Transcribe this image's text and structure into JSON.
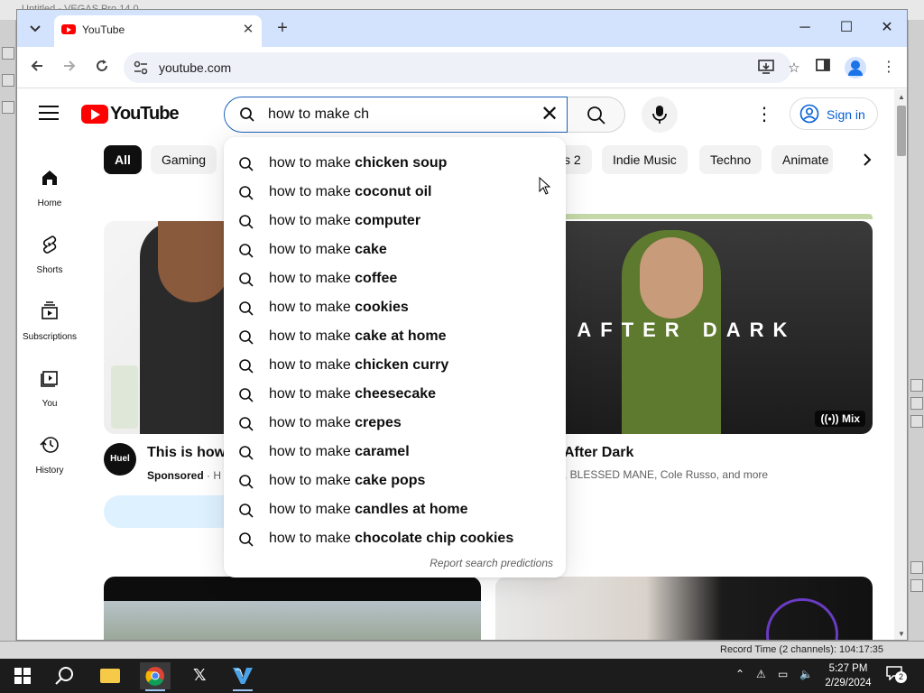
{
  "background_app": {
    "title": "Untitled - VEGAS Pro 14.0",
    "status_text": "Record Time (2 channels): 104:17:35"
  },
  "browser": {
    "tab_title": "YouTube",
    "url": "youtube.com",
    "window_controls": [
      "minimize",
      "maximize",
      "close"
    ]
  },
  "youtube": {
    "logo_text": "YouTube",
    "search_query": "how to make ch",
    "sign_in_label": "Sign in",
    "guide": [
      {
        "label": "Home",
        "icon": "home-icon"
      },
      {
        "label": "Shorts",
        "icon": "shorts-icon"
      },
      {
        "label": "Subscriptions",
        "icon": "subscriptions-icon"
      },
      {
        "label": "You",
        "icon": "you-icon"
      },
      {
        "label": "History",
        "icon": "history-icon"
      }
    ],
    "chips": [
      "All",
      "Gaming",
      "s 2",
      "Indie Music",
      "Techno",
      "Animate"
    ],
    "videos": [
      {
        "title": "This is how",
        "channel_label": "Sponsored",
        "channel_suffix": "· H",
        "avatar_text": "Huel"
      },
      {
        "title": "After Dark",
        "meta": ", BLESSED MANE, Cole Russo, and more",
        "thumb_text": "A AFTER DARK",
        "badge": "Mix"
      }
    ],
    "suggestions": [
      {
        "prefix": "how to make ",
        "bold": "chicken soup"
      },
      {
        "prefix": "how to make ",
        "bold": "coconut oil"
      },
      {
        "prefix": "how to make ",
        "bold": "computer"
      },
      {
        "prefix": "how to make ",
        "bold": "cake"
      },
      {
        "prefix": "how to make ",
        "bold": "coffee"
      },
      {
        "prefix": "how to make ",
        "bold": "cookies"
      },
      {
        "prefix": "how to make ",
        "bold": "cake at home"
      },
      {
        "prefix": "how to make ",
        "bold": "chicken curry"
      },
      {
        "prefix": "how to make ",
        "bold": "cheesecake"
      },
      {
        "prefix": "how to make ",
        "bold": "crepes"
      },
      {
        "prefix": "how to make ",
        "bold": "caramel"
      },
      {
        "prefix": "how to make ",
        "bold": "cake pops"
      },
      {
        "prefix": "how to make ",
        "bold": "candles at home"
      },
      {
        "prefix": "how to make ",
        "bold": "chocolate chip cookies"
      }
    ],
    "report_label": "Report search predictions"
  },
  "taskbar": {
    "time": "5:27 PM",
    "date": "2/29/2024",
    "notification_count": "2"
  },
  "colors": {
    "accent": "#065fd4",
    "yt_red": "#ff0000",
    "tabstrip": "#d3e3fd"
  }
}
